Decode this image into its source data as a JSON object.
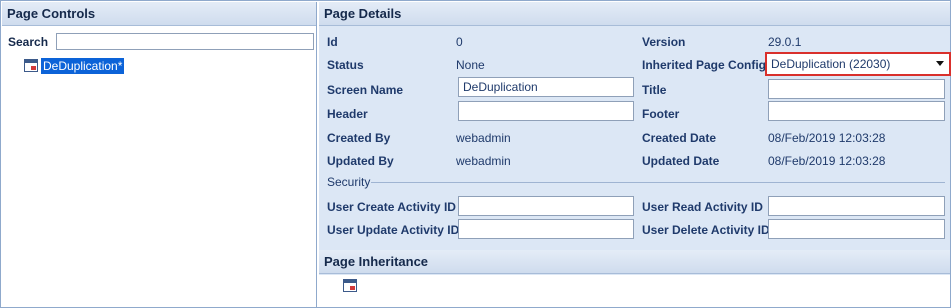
{
  "left_panel": {
    "title": "Page Controls",
    "search_label": "Search",
    "search_value": "",
    "tree": [
      {
        "label": "DeDuplication*",
        "selected": true,
        "icon": "page-config-icon"
      }
    ]
  },
  "details": {
    "title": "Page Details",
    "id_label": "Id",
    "id_value": "0",
    "version_label": "Version",
    "version_value": "29.0.1",
    "status_label": "Status",
    "status_value": "None",
    "inherited_label": "Inherited Page Config",
    "inherited_value": "DeDuplication (22030)",
    "screen_name_label": "Screen Name",
    "screen_name_value": "DeDuplication",
    "title_label": "Title",
    "title_value": "",
    "header_label": "Header",
    "header_value": "",
    "footer_label": "Footer",
    "footer_value": "",
    "created_by_label": "Created By",
    "created_by_value": "webadmin",
    "created_date_label": "Created Date",
    "created_date_value": "08/Feb/2019 12:03:28",
    "updated_by_label": "Updated By",
    "updated_by_value": "webadmin",
    "updated_date_label": "Updated Date",
    "updated_date_value": "08/Feb/2019 12:03:28",
    "security_title": "Security",
    "create_activity_label": "User Create Activity ID",
    "create_activity_value": "",
    "read_activity_label": "User Read Activity ID",
    "read_activity_value": "",
    "update_activity_label": "User Update Activity ID",
    "update_activity_value": "",
    "delete_activity_label": "User Delete Activity ID",
    "delete_activity_value": ""
  },
  "inheritance": {
    "title": "Page Inheritance",
    "icon": "page-config-icon"
  },
  "colors": {
    "accent": "#0c63d8",
    "highlight_border": "#d9302c",
    "panel_bg": "#dce7f5"
  }
}
